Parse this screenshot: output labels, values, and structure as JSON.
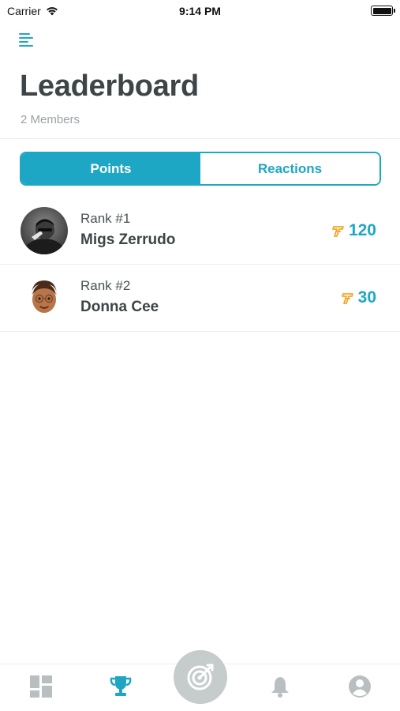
{
  "status_bar": {
    "carrier": "Carrier",
    "time": "9:14 PM"
  },
  "header": {
    "title": "Leaderboard",
    "subtitle": "2 Members",
    "menu_icon": "menu-icon"
  },
  "segmented_control": {
    "tabs": [
      {
        "label": "Points",
        "active": true
      },
      {
        "label": "Reactions",
        "active": false
      }
    ]
  },
  "leaderboard": {
    "rows": [
      {
        "rank": "Rank #1",
        "name": "Migs Zerrudo",
        "points": "120",
        "avatar": "photo-avatar"
      },
      {
        "rank": "Rank #2",
        "name": "Donna Cee",
        "points": "30",
        "avatar": "memoji-avatar"
      }
    ]
  },
  "tab_bar": {
    "items": [
      {
        "icon": "dashboard-icon",
        "active": false
      },
      {
        "icon": "trophy-icon",
        "active": true
      },
      {
        "icon": "target-icon",
        "active": false
      },
      {
        "icon": "bell-icon",
        "active": false
      },
      {
        "icon": "user-icon",
        "active": false
      }
    ]
  },
  "colors": {
    "accent": "#1ea7c5",
    "coin": "#f5a623",
    "title": "#3d4547",
    "muted": "#9aa1a3",
    "inactive_icon": "#b9bfc0"
  }
}
